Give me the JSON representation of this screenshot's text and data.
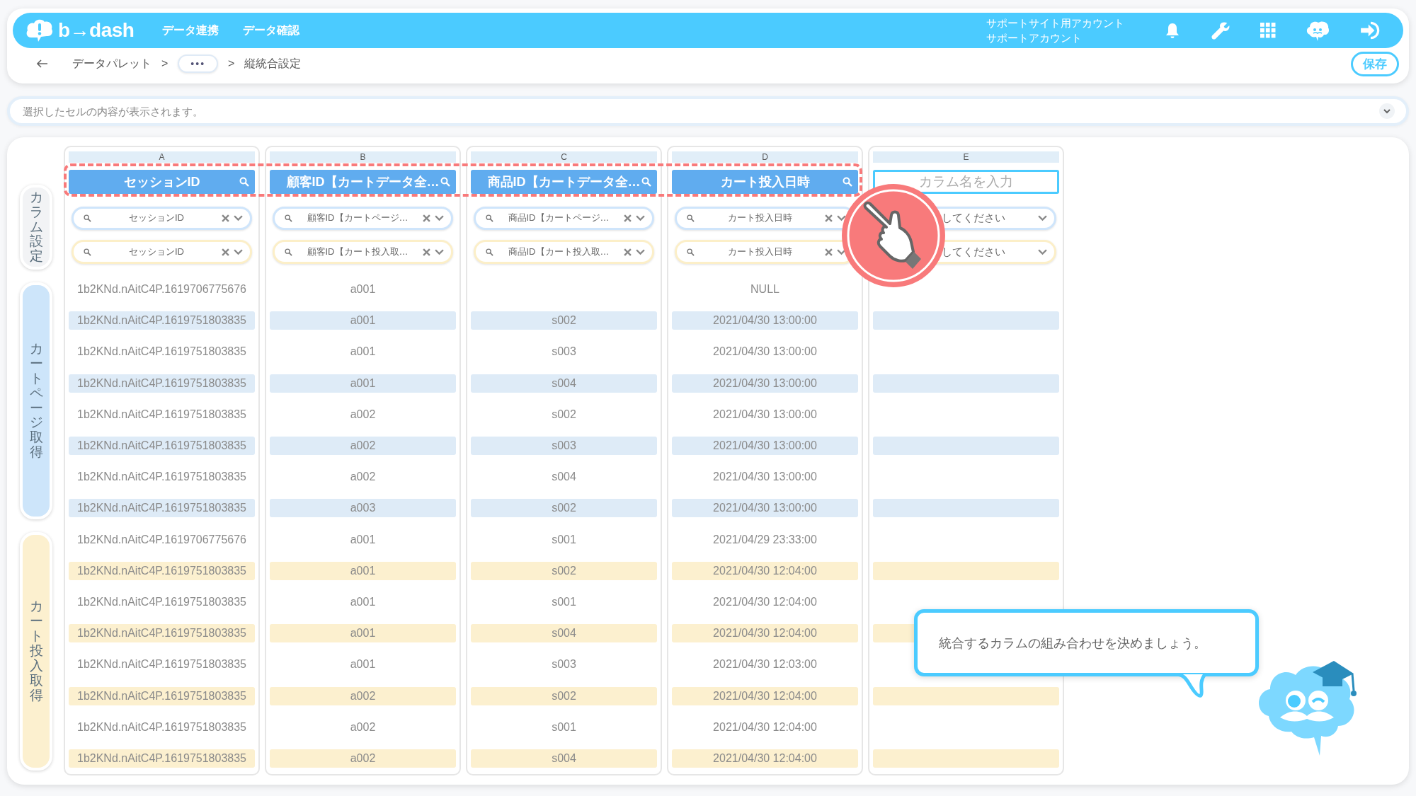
{
  "header": {
    "logo": "b→dash",
    "nav": [
      {
        "label": "データ連携"
      },
      {
        "label": "データ確認"
      }
    ],
    "account": [
      "サポートサイト用アカウント",
      "サポートアカウント"
    ]
  },
  "breadcrumb": [
    {
      "kind": "link",
      "label": "データパレット"
    },
    {
      "kind": "separator",
      "label": ">"
    },
    {
      "kind": "more",
      "label": "•••"
    },
    {
      "kind": "separator",
      "label": ">"
    },
    {
      "kind": "current",
      "label": "縦統合設定"
    }
  ],
  "save_button": "保存",
  "cell_viewer": {
    "placeholder": "選択したセルの内容が表示されます。"
  },
  "side_tabs": [
    {
      "label": "カラム設定",
      "kind": "settings"
    },
    {
      "label": "カートページ取得",
      "kind": "cart_page"
    },
    {
      "label": "カート投入取得",
      "kind": "cart_add"
    }
  ],
  "columns": [
    {
      "letter": "A",
      "kind": "header",
      "title": "セッションID",
      "filters": [
        {
          "kind": "cart_page",
          "text": "セッションID"
        },
        {
          "kind": "cart_add",
          "text": "セッションID"
        }
      ]
    },
    {
      "letter": "B",
      "kind": "header",
      "title": "顧客ID【カートデータ全…",
      "filters": [
        {
          "kind": "cart_page",
          "text": "顧客ID【カートページ…"
        },
        {
          "kind": "cart_add",
          "text": "顧客ID【カート投入取…"
        }
      ]
    },
    {
      "letter": "C",
      "kind": "header",
      "title": "商品ID【カートデータ全…",
      "filters": [
        {
          "kind": "cart_page",
          "text": "商品ID【カートページ…"
        },
        {
          "kind": "cart_add",
          "text": "商品ID【カート投入取…"
        }
      ]
    },
    {
      "letter": "D",
      "kind": "header",
      "title": "カート投入日時",
      "filters": [
        {
          "kind": "cart_page",
          "text": "カート投入日時"
        },
        {
          "kind": "cart_add",
          "text": "カート投入日時"
        }
      ]
    },
    {
      "letter": "E",
      "kind": "input",
      "placeholder": "カラム名を入力",
      "filters": [
        {
          "kind": "cart_page",
          "text": "してください"
        },
        {
          "kind": "cart_add",
          "text": "してください"
        }
      ]
    }
  ],
  "rows": [
    {
      "shaded": false,
      "cells": [
        "1b2KNd.nAitC4P.1619706775676",
        "a001",
        null,
        "NULL"
      ]
    },
    {
      "kind": "cart_page",
      "shaded": true,
      "cells": [
        "1b2KNd.nAitC4P.1619751803835",
        "a001",
        "s002",
        "2021/04/30 13:00:00"
      ]
    },
    {
      "shaded": false,
      "cells": [
        "1b2KNd.nAitC4P.1619751803835",
        "a001",
        "s003",
        "2021/04/30 13:00:00"
      ]
    },
    {
      "kind": "cart_page",
      "shaded": true,
      "cells": [
        "1b2KNd.nAitC4P.1619751803835",
        "a001",
        "s004",
        "2021/04/30 13:00:00"
      ]
    },
    {
      "shaded": false,
      "cells": [
        "1b2KNd.nAitC4P.1619751803835",
        "a002",
        "s002",
        "2021/04/30 13:00:00"
      ]
    },
    {
      "kind": "cart_page",
      "shaded": true,
      "cells": [
        "1b2KNd.nAitC4P.1619751803835",
        "a002",
        "s003",
        "2021/04/30 13:00:00"
      ]
    },
    {
      "shaded": false,
      "cells": [
        "1b2KNd.nAitC4P.1619751803835",
        "a002",
        "s004",
        "2021/04/30 13:00:00"
      ]
    },
    {
      "kind": "cart_page",
      "shaded": true,
      "cells": [
        "1b2KNd.nAitC4P.1619751803835",
        "a003",
        "s002",
        "2021/04/30 13:00:00"
      ]
    },
    {
      "shaded": false,
      "cells": [
        "1b2KNd.nAitC4P.1619706775676",
        "a001",
        "s001",
        "2021/04/29 23:33:00"
      ]
    },
    {
      "kind": "cart_add",
      "shaded": true,
      "cells": [
        "1b2KNd.nAitC4P.1619751803835",
        "a001",
        "s002",
        "2021/04/30 12:04:00"
      ]
    },
    {
      "shaded": false,
      "cells": [
        "1b2KNd.nAitC4P.1619751803835",
        "a001",
        "s001",
        "2021/04/30 12:04:00"
      ]
    },
    {
      "kind": "cart_add",
      "shaded": true,
      "cells": [
        "1b2KNd.nAitC4P.1619751803835",
        "a001",
        "s004",
        "2021/04/30 12:04:00"
      ]
    },
    {
      "shaded": false,
      "cells": [
        "1b2KNd.nAitC4P.1619751803835",
        "a001",
        "s003",
        "2021/04/30 12:03:00"
      ]
    },
    {
      "kind": "cart_add",
      "shaded": true,
      "cells": [
        "1b2KNd.nAitC4P.1619751803835",
        "a002",
        "s002",
        "2021/04/30 12:04:00"
      ]
    },
    {
      "shaded": false,
      "cells": [
        "1b2KNd.nAitC4P.1619751803835",
        "a002",
        "s001",
        "2021/04/30 12:04:00"
      ]
    },
    {
      "kind": "cart_add",
      "shaded": true,
      "cells": [
        "1b2KNd.nAitC4P.1619751803835",
        "a002",
        "s004",
        "2021/04/30 12:04:00"
      ]
    }
  ],
  "tooltip": {
    "text": "統合するカラムの組み合わせを決めましょう。"
  }
}
